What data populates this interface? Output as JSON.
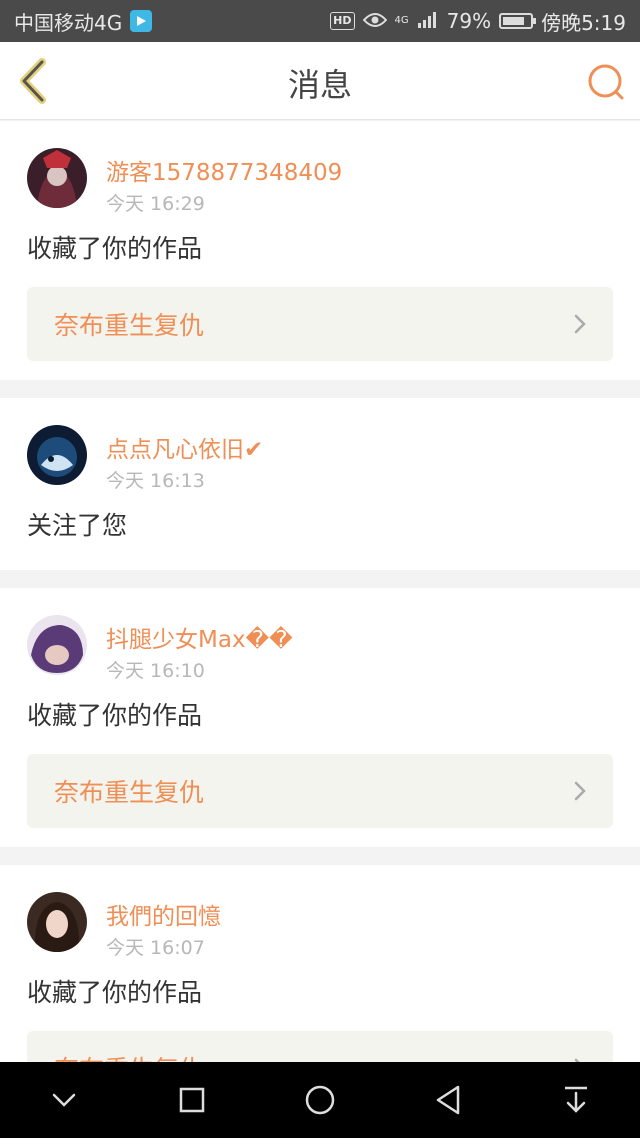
{
  "status_bar": {
    "carrier": "中国移动4G",
    "hd": "HD",
    "net": "4G",
    "battery_percent": "79%",
    "battery_level": 0.79,
    "time": "傍晚5:19"
  },
  "header": {
    "title": "消息",
    "back_icon": "chevron-left-icon",
    "search_icon": "search-icon"
  },
  "messages": [
    {
      "username": "游客1578877348409",
      "time": "今天 16:29",
      "action": "收藏了你的作品",
      "work_title": "奈布重生复仇"
    },
    {
      "username": "点点凡心依旧✔",
      "time": "今天 16:13",
      "action": "关注了您"
    },
    {
      "username": "抖腿少女Max��",
      "time": "今天 16:10",
      "action": "收藏了你的作品",
      "work_title": "奈布重生复仇"
    },
    {
      "username": "我們的回憶",
      "time": "今天 16:07",
      "action": "收藏了你的作品",
      "work_title": "奈布重生复仇"
    }
  ],
  "colors": {
    "accent": "#ef8f55",
    "status_bar_bg": "#4a4a4a",
    "nav_bar_bg": "#000000"
  }
}
